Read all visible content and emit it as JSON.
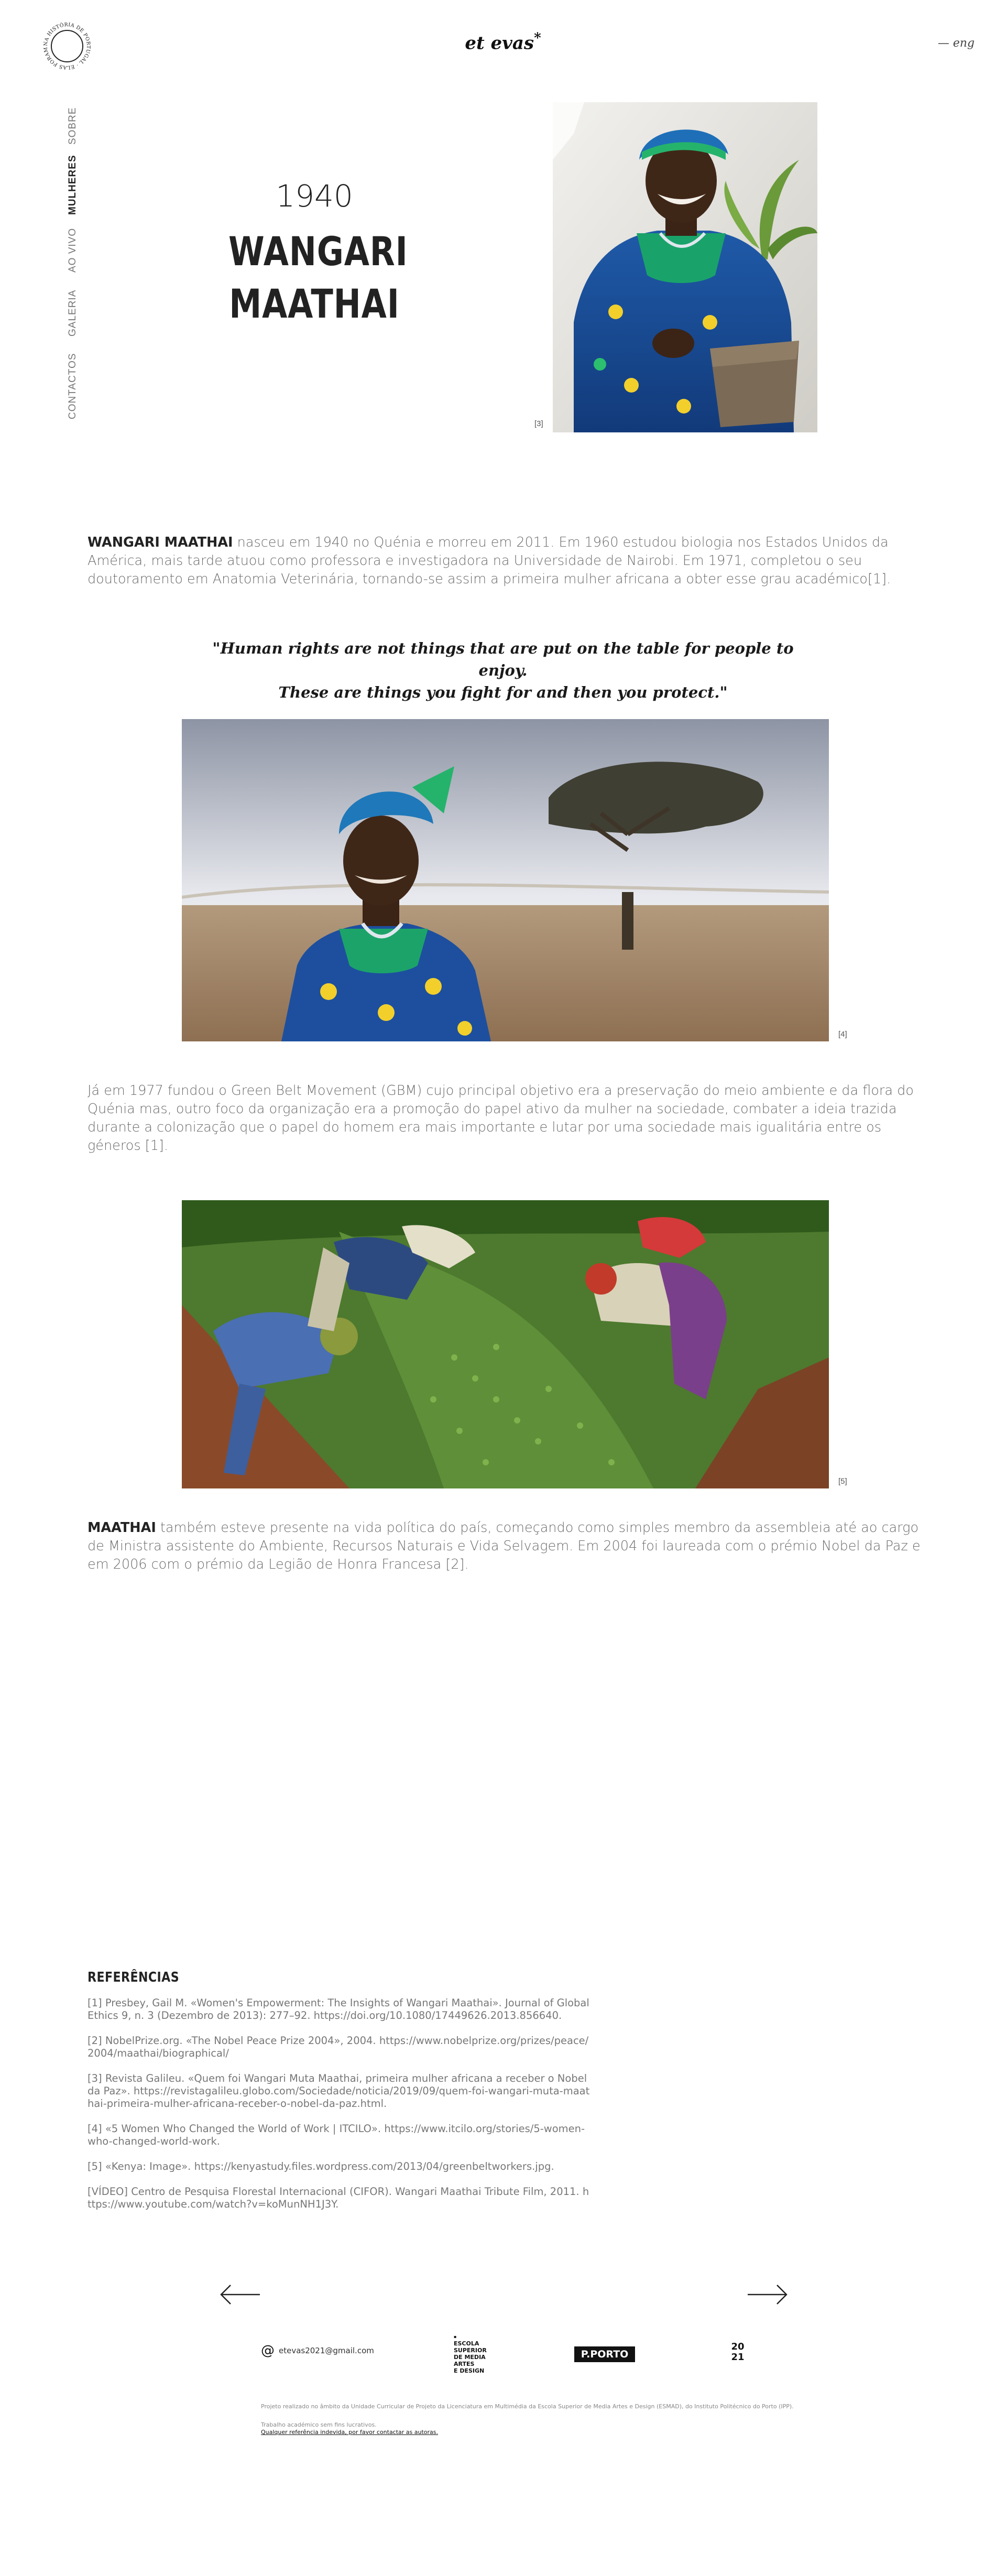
{
  "header": {
    "logo_ring_text": "NA HISTÓRIA DE PORTUGAL · ELAS FORAM AS PRIMEIRAS ·",
    "brand": "et evas",
    "brand_mark": "*",
    "language_link": "— eng"
  },
  "nav": {
    "items": [
      {
        "label": "SOBRE",
        "active": false
      },
      {
        "label": "MULHERES",
        "active": true
      },
      {
        "label": "AO VIVO",
        "active": false
      },
      {
        "label": "GALERIA",
        "active": false
      },
      {
        "label": "CONTACTOS",
        "active": false
      }
    ]
  },
  "hero": {
    "year": "1940",
    "name_line1": "WANGARI",
    "name_line2": "MAATHAI",
    "image_ref": "[3]"
  },
  "intro": {
    "name": "WANGARI MAATHAI",
    "text": " nasceu em 1940 no Quénia e morreu em 2011. Em 1960 estudou biologia nos Estados Unidos da América, mais tarde atuou como professora e investigadora na Universidade de Nairobi. Em 1971, completou o seu doutoramento em Anatomia Veterinária, tornando-se assim a primeira mulher africana a obter esse grau académico[1]."
  },
  "quote": {
    "line1": "\"Human rights are not things that are put on the table for people to enjoy.",
    "line2": "These are things you fight for and then you protect.\""
  },
  "photo2": {
    "ref": "[4]"
  },
  "paragraph2": {
    "text": "Já em 1977 fundou o Green Belt Movement (GBM) cujo principal objetivo era a preservação do meio ambiente e da flora do Quénia mas, outro foco da organização era a promoção do papel ativo da mulher na sociedade, combater a ideia trazida durante a colonização que o papel do homem era mais importante e lutar por uma sociedade mais igualitária entre os géneros [1]."
  },
  "photo3": {
    "ref": "[5]"
  },
  "paragraph3": {
    "name": "MAATHAI",
    "text": " também esteve presente na vida política do país, começando como simples membro da assembleia até ao cargo de Ministra assistente do Ambiente, Recursos Naturais e Vida Selvagem. Em 2004 foi laureada com o prémio Nobel da Paz e em 2006 com o prémio da Legião de Honra Francesa [2]."
  },
  "references": {
    "title": "REFERÊNCIAS",
    "items": [
      "[1] Presbey, Gail M. «Women's Empowerment: The Insights of Wangari Maathai». Journal of Global Ethics 9, n. 3 (Dezembro de 2013): 277–92. https://doi.org/10.1080/17449626.2013.856640.",
      "[2] NobelPrize.org. «The Nobel Peace Prize 2004», 2004. https://www.nobelprize.org/prizes/peace/2004/maathai/biographical/",
      "[3] Revista Galileu. «Quem foi Wangari Muta Maathai, primeira mulher africana a receber o Nobel da Paz». https://revistagalileu.globo.com/Sociedade/noticia/2019/09/quem-foi-wangari-muta-maathai-primeira-mulher-africana-receber-o-nobel-da-paz.html.",
      "[4] «5 Women Who Changed the World of Work | ITCILO». https://www.itcilo.org/stories/5-women-who-changed-world-work.",
      "[5] «Kenya: Image». https://kenyastudy.files.wordpress.com/2013/04/greenbeltworkers.jpg.",
      "[VÍDEO] Centro de Pesquisa Florestal Internacional (CIFOR). Wangari Maathai Tribute Film, 2011. https://www.youtube.com/watch?v=koMunNH1J3Y."
    ]
  },
  "footer": {
    "email": "etevas2021@gmail.com",
    "esmad_lines": [
      "ESCOLA",
      "SUPERIOR",
      "DE MEDIA",
      "ARTES",
      "E DESIGN"
    ],
    "pporto": "P.PORTO",
    "year_top": "20",
    "year_bottom": "21",
    "credit": "Projeto realizado no âmbito da Unidade Curricular de Projeto da Licenciatura em Multimédia da Escola Superior de Media Artes e Design (ESMAD), do Instituto Politécnico do Porto (IPP).",
    "disclaimer": "Trabalho académico sem fins lucrativos.",
    "report_link": "Qualquer referência indevida, por favor contactar as autoras."
  }
}
